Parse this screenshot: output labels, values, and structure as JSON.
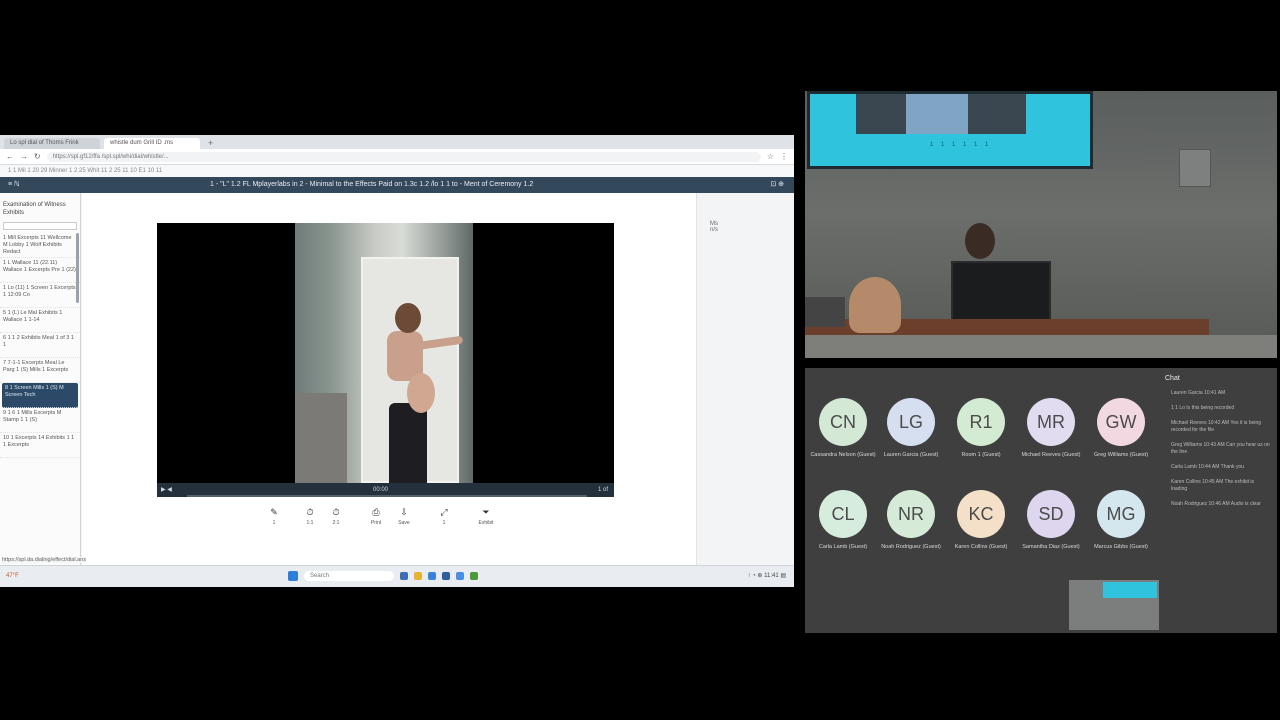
{
  "colors": {
    "background": "#000000",
    "app_header": "#34485c",
    "room_screen": "#2fc3dd",
    "participants_bg": "#3f3f3f"
  },
  "browser": {
    "tabs": [
      "Lo spl dial of Thoms Frink",
      "whistle dum Grill ID .ms"
    ],
    "new_tab": "+",
    "url": "https://spl.gf12/ffa /spl.spl/whi/dial/whistle/...",
    "bookmarks": "1 1 Mil 1 20 29 Minner 1 2 25 Whit 11 2 25 11 10 E1 10 11",
    "nav_icons": [
      "back-icon",
      "forward-icon",
      "reload-icon"
    ]
  },
  "app": {
    "menu_label": "≡ ℕ",
    "title": "1 - \"L\" 1.2 FL  Mplayerlabs in 2 - Minimal to the Effects Paid on 1.3c  1.2  /lo 1 1 to - Ment of Ceremony 1.2",
    "right_controls": "⊡ ⊕"
  },
  "left_pane": {
    "title": "Examination of Witness Exhibits",
    "items": [
      "1 Mill Excerpts 11 Wellcome M Lobby 1 Wolf Exhibits Redact",
      "1 L Wallace 11 (22.11) Wallace 1 Excerpts Pre 1 (22)",
      "1 Lo (11) 1 Screen 1 Excerpts 1 12:09 Co",
      "5 1 (L) Le Mal Exhibits 1 Wallace 1 1-14",
      "6 1 1 2 Exhibits Meal 1 of 3 1 1",
      "7 7-1-1 Excerpts Meal Le Parg 1 (S) Mills 1 Excerpts",
      "8 1 Screen Mills 1 (S) M Screen Tech",
      "9 1 6 1 Mills Excerpts M Stamp 1 1 (S)",
      "10 1 Excerpts 14 Exhibits 1 1 1 Excerpts"
    ],
    "selected_index": 6
  },
  "video": {
    "time": "00:00",
    "end_label": "1 of",
    "progress": 0.0
  },
  "toolbar": [
    {
      "icon": "pen-icon",
      "glyph": "✎",
      "label": "1"
    },
    {
      "icon": "clock-icon",
      "glyph": "⏱",
      "label": "1:1"
    },
    {
      "icon": "clock-icon-2",
      "glyph": "⏱",
      "label": "2:1"
    },
    {
      "icon": "print-icon",
      "glyph": "⎙",
      "label": "Print"
    },
    {
      "icon": "save-icon",
      "glyph": "⇩",
      "label": "Save"
    },
    {
      "icon": "fullscreen-icon",
      "glyph": "⤢",
      "label": "1"
    },
    {
      "icon": "filter-icon",
      "glyph": "⏷",
      "label": "Exhibit"
    }
  ],
  "side_note": "Ms n/s",
  "status_line": "https://spl.da.dialing/effect/dial.ans",
  "taskbar": {
    "weather": "47°F",
    "search_placeholder": "Search",
    "tray": "↑ ◔ ⊕ 11:41 ▤"
  },
  "camera": {
    "screen_text": "1 1 1 1 1 1"
  },
  "participants": [
    {
      "initials": "CN",
      "name": "Cassandra Nelson (Guest)",
      "color": "#d4e8d6"
    },
    {
      "initials": "LG",
      "name": "Lauren Garcia (Guest)",
      "color": "#d6dff0"
    },
    {
      "initials": "R1",
      "name": "Room 1 (Guest)",
      "color": "#d3ead3"
    },
    {
      "initials": "MR",
      "name": "Michael Reeves (Guest)",
      "color": "#e1dcef"
    },
    {
      "initials": "GW",
      "name": "Greg Williams (Guest)",
      "color": "#f2d9e1"
    },
    {
      "initials": "CL",
      "name": "Carla Lamb (Guest)",
      "color": "#d6ecdc"
    },
    {
      "initials": "NR",
      "name": "Noah Rodriguez (Guest)",
      "color": "#d5ebd7"
    },
    {
      "initials": "KC",
      "name": "Karen Collins (Guest)",
      "color": "#f4dfc8"
    },
    {
      "initials": "SD",
      "name": "Samantha Diaz (Guest)",
      "color": "#ddd6ee"
    },
    {
      "initials": "MG",
      "name": "Marcus Gibbs (Guest)",
      "color": "#d5e7ee"
    }
  ],
  "chat": {
    "title": "Chat",
    "messages": [
      "Lauren Garcia 10:41 AM",
      "1 1 Lo Is this being recorded",
      "Michael Reeves 10:42 AM Yes it is being recorded for the file",
      "Greg Williams 10:43 AM Can you hear us on the line",
      "Carla Lamb 10:44 AM Thank you",
      "Karen Collins 10:45 AM The exhibit is loading",
      "Noah Rodriguez 10:46 AM Audio is clear"
    ]
  }
}
